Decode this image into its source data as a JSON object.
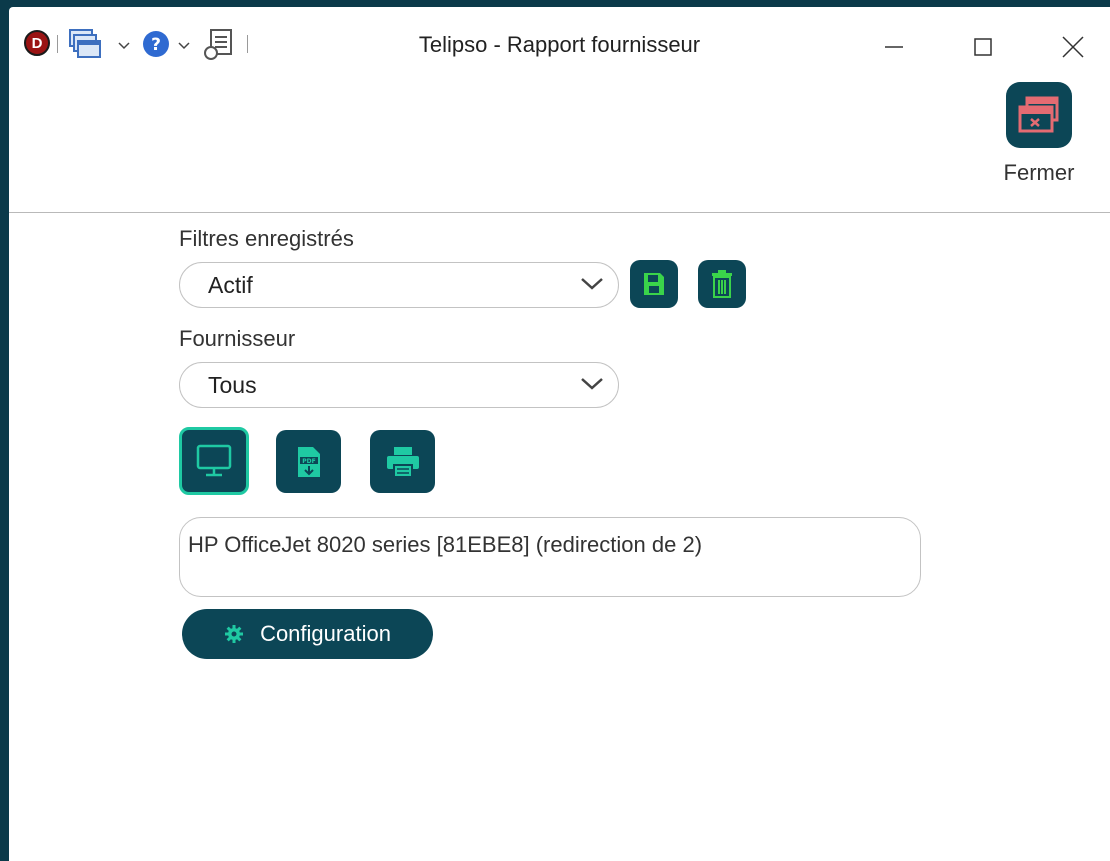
{
  "window": {
    "title": "Telipso - Rapport fournisseur",
    "logo_letter": "D"
  },
  "toolbar": {
    "icons": [
      "app-logo-icon",
      "windows-icon",
      "help-icon",
      "report-icon"
    ]
  },
  "ribbon": {
    "close_label": "Fermer"
  },
  "filters": {
    "saved_label": "Filtres enregistrés",
    "saved_value": "Actif",
    "supplier_label": "Fournisseur",
    "supplier_value": "Tous"
  },
  "output": {
    "printer": "HP OfficeJet 8020 series [81EBE8] (redirection de 2)",
    "config_label": "Configuration",
    "selected_mode": "screen"
  },
  "colors": {
    "accent": "#0c4656",
    "active_border": "#1fc9a3",
    "save_icon": "#3ad34a",
    "close_icon": "#e46b72"
  }
}
